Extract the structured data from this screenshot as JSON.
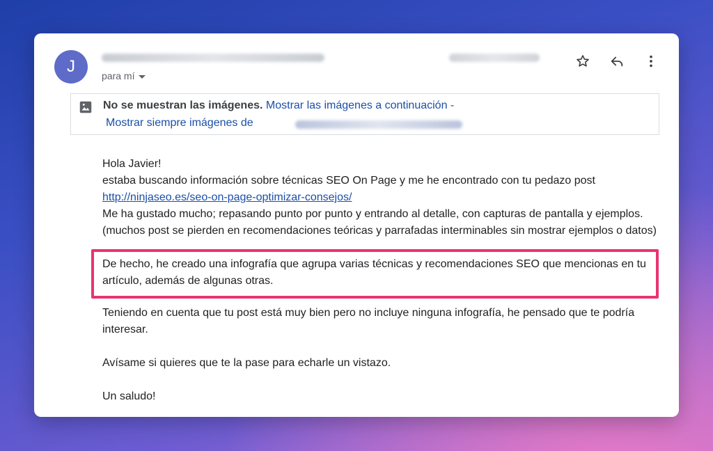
{
  "sender": {
    "avatar_letter": "J"
  },
  "recipient": {
    "label": "para mí"
  },
  "banner": {
    "bold": "No se muestran las imágenes.",
    "show_below": "Mostrar las imágenes a continuación",
    "separator": " -",
    "always_show": "Mostrar siempre imágenes de"
  },
  "message": {
    "greeting": "Hola Javier!",
    "line1": "estaba buscando información sobre técnicas SEO On Page y me he encontrado con tu pedazo post",
    "link": "http://ninjaseo.es/seo-on-page-optimizar-consejos/",
    "line2": "Me ha gustado mucho; repasando punto por punto y entrando al detalle, con capturas de pantalla y ejemplos.",
    "line3": "(muchos post se pierden en recomendaciones teóricas y parrafadas interminables sin mostrar ejemplos o datos)",
    "highlight": "De hecho, he creado una infografía que agrupa varias técnicas y recomendaciones SEO que mencionas en tu artículo, además de algunas otras.",
    "para2": "Teniendo en cuenta que tu post está muy bien pero no incluye ninguna infografía, he pensado que te podría interesar.",
    "para3": "Avísame si quieres que te la pase para echarle un vistazo.",
    "closing": "Un saludo!"
  },
  "icons": {
    "star": "star-icon",
    "reply": "reply-icon",
    "more": "more-vert-icon",
    "image": "image-icon"
  },
  "colors": {
    "avatar": "#5e6bc9",
    "link": "#1a4fa8",
    "highlight_border": "#e8356f"
  }
}
